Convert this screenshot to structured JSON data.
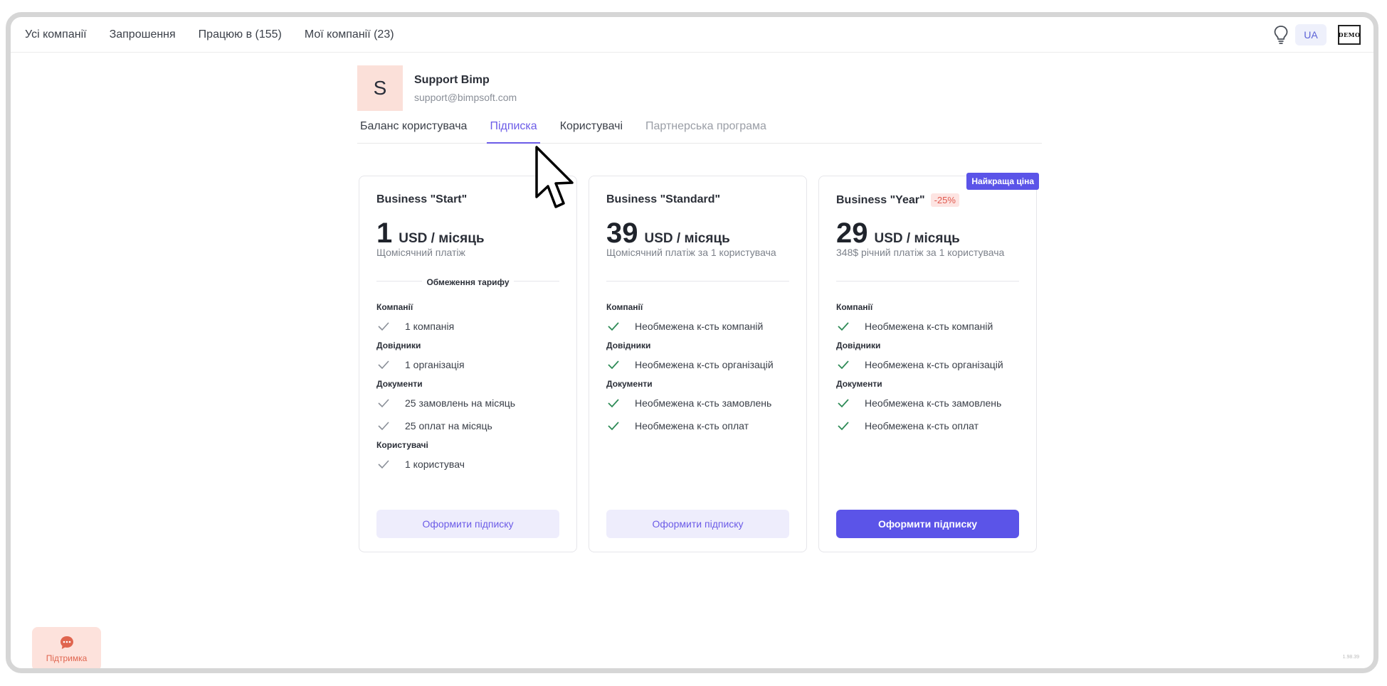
{
  "top_nav": {
    "items": [
      "Усі компанії",
      "Запрошення",
      "Працюю в (155)",
      "Мої компанії (23)"
    ],
    "language": "UA",
    "logo_text": "DEMO"
  },
  "profile": {
    "initial": "S",
    "name": "Support Bimp",
    "email": "support@bimpsoft.com"
  },
  "tabs": [
    {
      "label": "Баланс користувача",
      "state": "default"
    },
    {
      "label": "Підписка",
      "state": "active"
    },
    {
      "label": "Користувачі",
      "state": "default"
    },
    {
      "label": "Партнерська програма",
      "state": "muted"
    }
  ],
  "plans": [
    {
      "title": "Business \"Start\"",
      "price": "1",
      "unit": "USD / місяць",
      "description": "Щомісячний платіж",
      "limits_label": "Обмеження тарифу",
      "groups": [
        {
          "title": "Компанії",
          "items": [
            "1 компанія"
          ]
        },
        {
          "title": "Довідники",
          "items": [
            "1 організація"
          ]
        },
        {
          "title": "Документи",
          "items": [
            "25 замовлень на місяць",
            "25 оплат на місяць"
          ]
        },
        {
          "title": "Користувачі",
          "items": [
            "1 користувач"
          ]
        }
      ],
      "button": "Оформити підписку"
    },
    {
      "title": "Business \"Standard\"",
      "price": "39",
      "unit": "USD / місяць",
      "description": "Щомісячний платіж за 1 користувача",
      "groups": [
        {
          "title": "Компанії",
          "items": [
            "Необмежена к-сть компаній"
          ]
        },
        {
          "title": "Довідники",
          "items": [
            "Необмежена к-сть організацій"
          ]
        },
        {
          "title": "Документи",
          "items": [
            "Необмежена к-сть замовлень",
            "Необмежена к-сть оплат"
          ]
        }
      ],
      "button": "Оформити підписку"
    },
    {
      "title": "Business \"Year\"",
      "discount": "-25%",
      "badge": "Найкраща ціна",
      "price": "29",
      "unit": "USD / місяць",
      "description": "348$ річний платіж за 1 користувача",
      "groups": [
        {
          "title": "Компанії",
          "items": [
            "Необмежена к-сть компаній"
          ]
        },
        {
          "title": "Довідники",
          "items": [
            "Необмежена к-сть організацій"
          ]
        },
        {
          "title": "Документи",
          "items": [
            "Необмежена к-сть замовлень",
            "Необмежена к-сть оплат"
          ]
        }
      ],
      "button": "Оформити підписку"
    }
  ],
  "support_button": "Підтримка",
  "version": "1.98.39",
  "colors": {
    "accent": "#5b54e8",
    "check_muted": "#8a8f98",
    "check_green": "#2e8b57",
    "support_bg": "#fde2dc"
  }
}
